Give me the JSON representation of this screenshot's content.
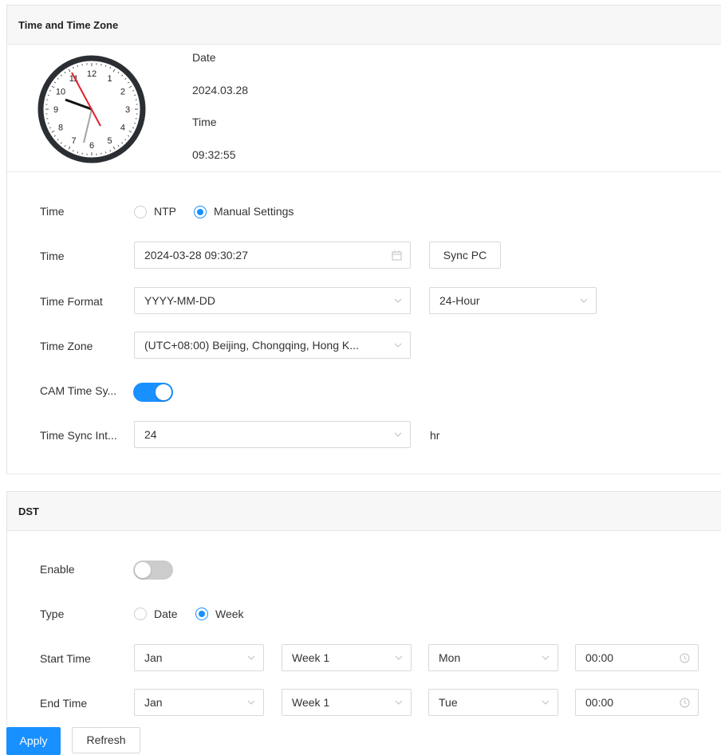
{
  "time_section": {
    "title": "Time and Time Zone",
    "date_label": "Date",
    "date_value": "2024.03.28",
    "time_label": "Time",
    "time_value": "09:32:55",
    "clock_numbers": [
      "12",
      "1",
      "2",
      "3",
      "4",
      "5",
      "6",
      "7",
      "8",
      "9",
      "10",
      "11"
    ],
    "form": {
      "time_mode_label": "Time",
      "ntp_label": "NTP",
      "manual_label": "Manual Settings",
      "time_mode_selected": "Manual Settings",
      "time_label": "Time",
      "time_value": "2024-03-28 09:30:27",
      "sync_pc_label": "Sync PC",
      "time_format_label": "Time Format",
      "date_format_value": "YYYY-MM-DD",
      "hour_format_value": "24-Hour",
      "time_zone_label": "Time Zone",
      "time_zone_value": "(UTC+08:00) Beijing, Chongqing, Hong K...",
      "cam_sync_label": "CAM Time Sy...",
      "cam_sync_enabled": true,
      "sync_interval_label": "Time Sync Int...",
      "sync_interval_value": "24",
      "sync_interval_unit": "hr"
    }
  },
  "dst_section": {
    "title": "DST",
    "enable_label": "Enable",
    "enable_on": false,
    "type_label": "Type",
    "type_date_label": "Date",
    "type_week_label": "Week",
    "type_selected": "Week",
    "start_label": "Start Time",
    "start_month": "Jan",
    "start_week": "Week 1",
    "start_day": "Mon",
    "start_time": "00:00",
    "end_label": "End Time",
    "end_month": "Jan",
    "end_week": "Week 1",
    "end_day": "Tue",
    "end_time": "00:00"
  },
  "footer": {
    "apply_label": "Apply",
    "refresh_label": "Refresh"
  },
  "colors": {
    "accent": "#1890ff",
    "toggle_off": "#cccccc",
    "hour_hand": "#111111",
    "minute_hand": "#999999",
    "second_hand": "#e0202a"
  }
}
